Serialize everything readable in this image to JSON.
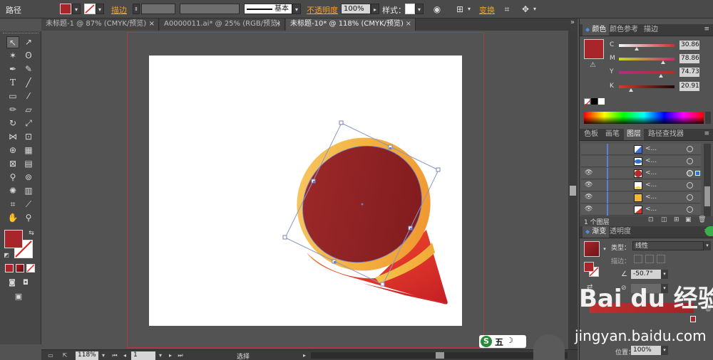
{
  "toolbar": {
    "object_type": "路径",
    "stroke_link": "描边",
    "stroke_style": "基本",
    "opacity_link": "不透明度",
    "opacity_value": "100%",
    "style_label": "样式：",
    "transform_link": "变换",
    "fill_color": "#a8262a"
  },
  "tabs": [
    {
      "label": "未标题-1 @ 87% (CMYK/预览)",
      "close": "×"
    },
    {
      "label": "A0000011.ai* @ 25% (RGB/预览)",
      "close": "×"
    },
    {
      "label": "未标题-10* @ 118% (CMYK/预览)",
      "close": "×"
    }
  ],
  "color_panel": {
    "tabs": [
      "颜色",
      "颜色参考",
      "描边"
    ],
    "channels": [
      {
        "name": "C",
        "value": "30.86",
        "gradient": [
          "#e9f8fb",
          "#cf2d2d"
        ],
        "pos": 0.31
      },
      {
        "name": "M",
        "value": "78.86",
        "gradient": [
          "#c9d62b",
          "#c12e6e"
        ],
        "pos": 0.79
      },
      {
        "name": "Y",
        "value": "74.73",
        "gradient": [
          "#b02d86",
          "#b3301f"
        ],
        "pos": 0.75
      },
      {
        "name": "K",
        "value": "20.91",
        "gradient": [
          "#d73a30",
          "#1c0808"
        ],
        "pos": 0.21
      }
    ],
    "fill_color": "#a8262a"
  },
  "layers_panel": {
    "tabs": [
      "色板",
      "画笔",
      "图层",
      "路径查找器"
    ],
    "rows": [
      {
        "name": "<...",
        "thumb": "#3b6fd6",
        "visible": false
      },
      {
        "name": "<...",
        "thumb": "#2c74c9",
        "visible": false
      },
      {
        "name": "<...",
        "thumb": "#b52a2a",
        "visible": true
      },
      {
        "name": "<...",
        "thumb": "#f3d25a",
        "visible": true
      },
      {
        "name": "<...",
        "thumb": "#f0b73a",
        "visible": true
      },
      {
        "name": "<...",
        "thumb": "#d8312b",
        "visible": true
      }
    ],
    "footer": "1 个图层"
  },
  "gradient_panel": {
    "tabs": [
      "渐变",
      "透明度"
    ],
    "type_label": "类型：",
    "type_value": "线性",
    "stroke_label": "描边：",
    "angle": "-50.7°",
    "position_label": "位置：",
    "position_value": "100%"
  },
  "status": {
    "zoom": "118%",
    "page": "1",
    "mode": "选择"
  },
  "watermarks": {
    "brand": "Bai du 经验",
    "url": "jingyan.baidu.com",
    "ime": "五"
  }
}
